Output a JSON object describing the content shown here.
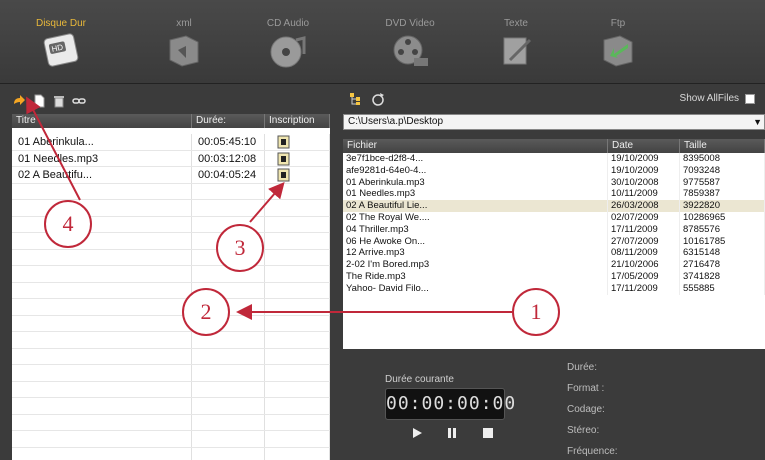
{
  "sources": [
    {
      "label": "Disque Dur",
      "icon": "hard-drive-icon",
      "active": true
    },
    {
      "label": "xml",
      "icon": "xml-box-icon",
      "active": false
    },
    {
      "label": "CD Audio",
      "icon": "cd-audio-icon",
      "active": false
    },
    {
      "label": "DVD Video",
      "icon": "film-reel-icon",
      "active": false
    },
    {
      "label": "Texte",
      "icon": "notepad-pen-icon",
      "active": false
    },
    {
      "label": "Ftp",
      "icon": "ftp-arrow-box-icon",
      "active": false
    }
  ],
  "left": {
    "columns": [
      "Titre",
      "Durée:",
      "Inscription"
    ],
    "rows": [
      {
        "title": "01 Aberinkula...",
        "duration": "00:05:45:10"
      },
      {
        "title": "01 Needles.mp3",
        "duration": "00:03:12:08"
      },
      {
        "title": "02 A Beautifu...",
        "duration": "00:04:05:24"
      }
    ]
  },
  "right": {
    "show_all_label": "Show AllFiles",
    "path": "C:\\Users\\a.p\\Desktop",
    "columns": [
      "Fichier",
      "Date",
      "Taille"
    ],
    "rows": [
      {
        "name": "3e7f1bce-d2f8-4...",
        "date": "19/10/2009",
        "size": "8395008"
      },
      {
        "name": "afe9281d-64e0-4...",
        "date": "19/10/2009",
        "size": "7093248"
      },
      {
        "name": "01 Aberinkula.mp3",
        "date": "30/10/2008",
        "size": "9775587"
      },
      {
        "name": "01 Needles.mp3",
        "date": "10/11/2009",
        "size": "7859387"
      },
      {
        "name": "02 A Beautiful Lie...",
        "date": "26/03/2008",
        "size": "3922820"
      },
      {
        "name": "02 The Royal We....",
        "date": "02/07/2009",
        "size": "10286965"
      },
      {
        "name": "04 Thriller.mp3",
        "date": "17/11/2009",
        "size": "8785576"
      },
      {
        "name": "06 He Awoke On...",
        "date": "27/07/2009",
        "size": "10161785"
      },
      {
        "name": "12 Arrive.mp3",
        "date": "08/11/2009",
        "size": "6315148"
      },
      {
        "name": "2-02 I'm Bored.mp3",
        "date": "21/10/2006",
        "size": "2716478"
      },
      {
        "name": "The Ride.mp3",
        "date": "17/05/2009",
        "size": "3741828"
      },
      {
        "name": "Yahoo- David Filo...",
        "date": "17/11/2009",
        "size": "555885"
      }
    ],
    "selected_index": 4
  },
  "player": {
    "label": "Durée courante",
    "time": "00:00:00:00"
  },
  "info": [
    "Durée:",
    "Format :",
    "Codage:",
    "Stéreo:",
    "Fréquence:"
  ],
  "callouts": [
    "4",
    "3",
    "2",
    "1"
  ],
  "colors": {
    "active_source": "#e8b83a",
    "callout": "#c0283a",
    "selected_row": "#ebe6d2"
  }
}
